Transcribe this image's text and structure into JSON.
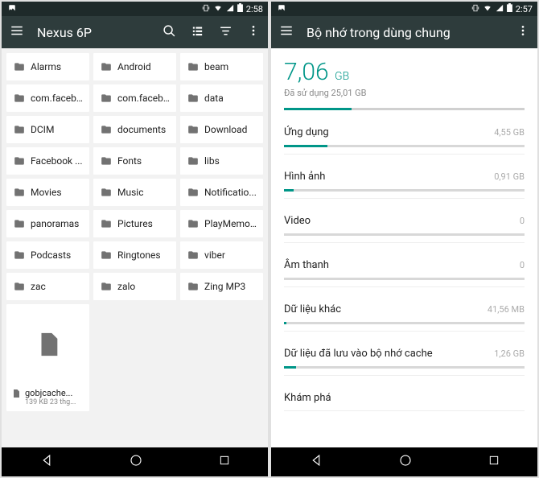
{
  "left": {
    "status_time": "2:58",
    "title": "Nexus 6P",
    "folders": [
      "Alarms",
      "Android",
      "beam",
      "com.faceb...",
      "com.faceb...",
      "data",
      "DCIM",
      "documents",
      "Download",
      "Facebook ...",
      "Fonts",
      "libs",
      "Movies",
      "Music",
      "Notificatio...",
      "panoramas",
      "Pictures",
      "PlayMemo...",
      "Podcasts",
      "Ringtones",
      "viber",
      "zac",
      "zalo",
      "Zing MP3"
    ],
    "file": {
      "name": "gobjcache...",
      "meta": "139 KB 23 thg..."
    }
  },
  "right": {
    "status_time": "2:57",
    "title": "Bộ nhớ trong dùng chung",
    "used_value": "7,06",
    "used_unit": "GB",
    "used_sub": "Đã sử dụng 25,01 GB",
    "used_pct": 28,
    "categories": [
      {
        "name": "Ứng dụng",
        "value": "4,55 GB",
        "pct": 18
      },
      {
        "name": "Hình ảnh",
        "value": "0,91 GB",
        "pct": 4
      },
      {
        "name": "Video",
        "value": "0",
        "pct": 0
      },
      {
        "name": "Âm thanh",
        "value": "0",
        "pct": 0
      },
      {
        "name": "Dữ liệu khác",
        "value": "41,56 MB",
        "pct": 1
      },
      {
        "name": "Dữ liệu đã lưu vào bộ nhớ cache",
        "value": "1,26 GB",
        "pct": 5
      },
      {
        "name": "Khám phá",
        "value": "",
        "pct": null
      }
    ]
  }
}
